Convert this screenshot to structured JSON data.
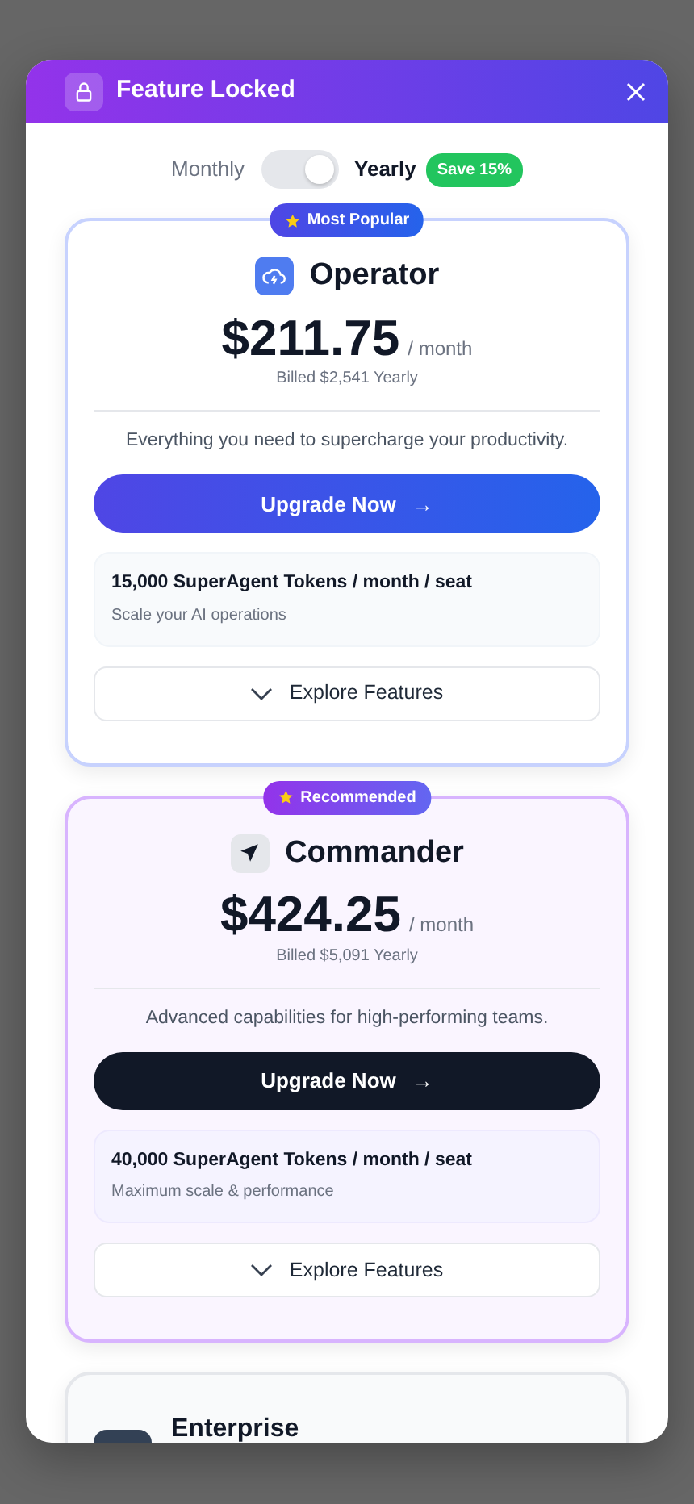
{
  "dialog": {
    "title": "Feature Locked"
  },
  "billing": {
    "options": [
      {
        "label": "Monthly",
        "selected": false
      },
      {
        "label": "Yearly",
        "selected": true
      }
    ],
    "toggle_on": true,
    "badge": "Save 15%"
  },
  "plans": [
    {
      "kind": "popular",
      "badge": "Most Popular",
      "name": "Operator",
      "price": "$211.75",
      "period": "/ month",
      "billed": "Billed $2,541 Yearly",
      "description": "Everything you need to supercharge your productivity.",
      "button": "Upgrade Now",
      "arrow": "→",
      "tokens": "15,000 SuperAgent Tokens / month / seat",
      "tokens_note": "Scale your AI operations",
      "explore": "Explore Features"
    },
    {
      "kind": "recommended",
      "badge": "Recommended",
      "name": "Commander",
      "price": "$424.25",
      "period": "/ month",
      "billed": "Billed $5,091 Yearly",
      "description": "Advanced capabilities for high-performing teams.",
      "button": "Upgrade Now",
      "arrow": "→",
      "tokens": "40,000 SuperAgent Tokens / month / seat",
      "tokens_note": "Maximum scale & performance",
      "explore": "Explore Features"
    },
    {
      "kind": "enterprise",
      "name": "Enterprise"
    }
  ]
}
